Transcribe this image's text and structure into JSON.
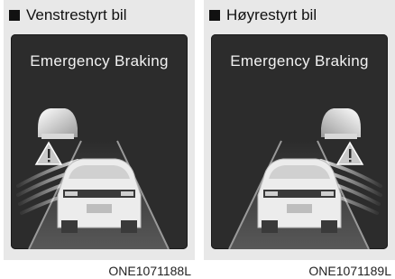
{
  "panels": [
    {
      "title": "Venstrestyrt bil",
      "screen_text": "Emergency Braking",
      "code": "ONE1071188L"
    },
    {
      "title": "Høyrestyrt bil",
      "screen_text": "Emergency Braking",
      "code": "ONE1071189L"
    }
  ],
  "icons": [
    "square-bullet-icon",
    "vehicle-ahead-icon",
    "warning-triangle-icon",
    "own-car-icon",
    "sensor-wave-icon"
  ],
  "colors": {
    "screen_background": "#2c2c2c",
    "panel_background": "#e8e8e8"
  }
}
